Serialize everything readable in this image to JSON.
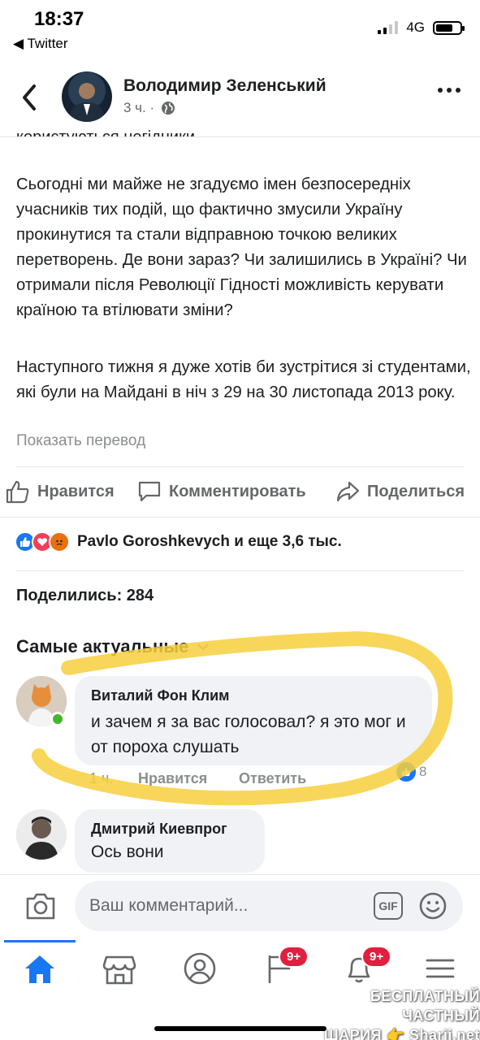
{
  "status_bar": {
    "time": "18:37",
    "back_app": "◀ Twitter",
    "network": "4G",
    "signal_bars": 2,
    "battery_level": 0.7
  },
  "header": {
    "page_name": "Володимир Зеленський",
    "time": "3 ч. ·",
    "privacy_icon": "globe-icon"
  },
  "post": {
    "cut_line": "користуються негідники.",
    "paragraph_1": "Сьогодні ми майже не згадуємо імен безпосередніх учасників тих подій, що фактично змусили Україну прокинутися та стали відправною точкою великих перетворень. Де вони зараз? Чи залишились в Україні? Чи отримали після Революції Гідності можливість керувати країною та втілювати зміни?",
    "paragraph_2": "Наступного тижня я дуже хотів би зустрітися зі студентами, які були на Майдані в ніч з 29 на 30 листопада 2013 року.",
    "translate_link": "Показать перевод"
  },
  "actions": {
    "like": "Нравится",
    "comment": "Комментировать",
    "share": "Поделиться"
  },
  "reactions": {
    "text": "Pavlo Goroshkevych и еще 3,6 тыс.",
    "types": [
      "like",
      "love",
      "angry"
    ]
  },
  "shares": "Поделились: 284",
  "sort_label": "Самые актуальные",
  "comments": [
    {
      "author": "Виталий Фон Клим",
      "text": "и зачем я за вас голосовал? я это мог и от пороха слушать",
      "time": "1 ч.",
      "like": "Нравится",
      "reply": "Ответить",
      "reaction_count": "8"
    },
    {
      "author": "Дмитрий Киевпрог",
      "text": "Ось вони"
    }
  ],
  "composer": {
    "placeholder": "Ваш комментарий...",
    "gif_label": "GIF"
  },
  "tabbar": {
    "badge_pages": "9+",
    "badge_notifications": "9+",
    "active_tab": "home"
  },
  "watermark": {
    "line_1": "БЕСПЛАТНЫЙ ЧАСТНЫЙ",
    "line_2": "ШАРИЯ 👉 Sharij.net"
  },
  "colors": {
    "accent": "#1877f2",
    "marker": "#f7cf3d",
    "badge": "#e41e3f",
    "online": "#42b72a"
  }
}
